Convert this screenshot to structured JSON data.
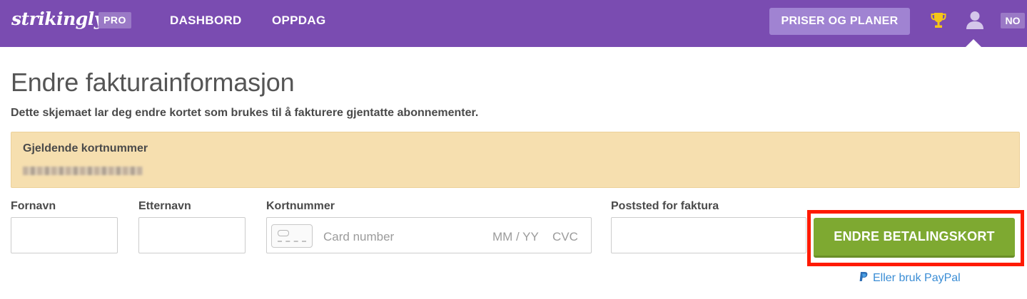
{
  "nav": {
    "logo": "strikingly",
    "pro_badge": "PRO",
    "dashboard": "DASHBORD",
    "discover": "OPPDAG",
    "pricing": "PRISER OG PLANER",
    "language": "NO"
  },
  "page": {
    "title": "Endre fakturainformasjon",
    "subtitle": "Dette skjemaet lar deg endre kortet som brukes til å fakturere gjentatte abonnementer."
  },
  "current_card": {
    "label": "Gjeldende kortnummer"
  },
  "form": {
    "first_name_label": "Fornavn",
    "first_name_value": "",
    "last_name_label": "Etternavn",
    "last_name_value": "",
    "card_label": "Kortnummer",
    "card_placeholder": "Card number",
    "expiry_placeholder": "MM / YY",
    "cvc_placeholder": "CVC",
    "postal_label": "Poststed for faktura",
    "postal_value": "",
    "submit": "ENDRE BETALINGSKORT",
    "paypal": "Eller bruk PayPal"
  },
  "colors": {
    "nav_bg": "#7a4cb1",
    "alert_bg": "#f6dfaf",
    "submit_bg": "#7ea931",
    "highlight": "#ff1a00",
    "link": "#3a8dd5"
  },
  "icons": [
    "trophy-icon",
    "user-icon",
    "credit-card-icon",
    "paypal-icon"
  ]
}
